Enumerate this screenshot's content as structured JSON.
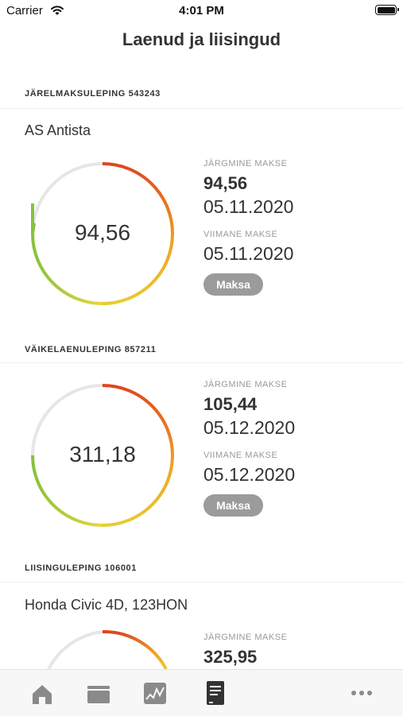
{
  "status_bar": {
    "carrier": "Carrier",
    "time": "4:01 PM"
  },
  "page": {
    "title": "Laenud ja liisingud"
  },
  "colors": {
    "gauge_gradient": [
      "#e0441f",
      "#f0a020",
      "#e6d83a",
      "#8cc63f"
    ],
    "gauge_track": "#e6e6e6",
    "button": "#9b9b9b"
  },
  "contracts": [
    {
      "heading": "JÄRELMAKSULEPING 543243",
      "subtitle": "AS Antista",
      "gauge_value": "94,56",
      "next_label": "JÄRGMINE MAKSE",
      "next_amount": "94,56",
      "next_date": "05.11.2020",
      "last_label": "VIIMANE MAKSE",
      "last_date": "05.11.2020",
      "pay_label": "Maksa"
    },
    {
      "heading": "VÄIKELAENULEPING 857211",
      "gauge_value": "311,18",
      "next_label": "JÄRGMINE MAKSE",
      "next_amount": "105,44",
      "next_date": "05.12.2020",
      "last_label": "VIIMANE MAKSE",
      "last_date": "05.12.2020",
      "pay_label": "Maksa"
    },
    {
      "heading": "LIISINGULEPING 106001",
      "subtitle": "Honda Civic 4D, 123HON",
      "next_label": "JÄRGMINE MAKSE",
      "next_amount": "325,95"
    }
  ],
  "tab_bar": {
    "tabs": [
      {
        "icon": "home-icon",
        "active": false
      },
      {
        "icon": "wallet-icon",
        "active": false
      },
      {
        "icon": "chart-icon",
        "active": false
      },
      {
        "icon": "contract-document-icon",
        "active": true
      },
      {
        "icon": "more-icon",
        "active": false
      }
    ]
  }
}
